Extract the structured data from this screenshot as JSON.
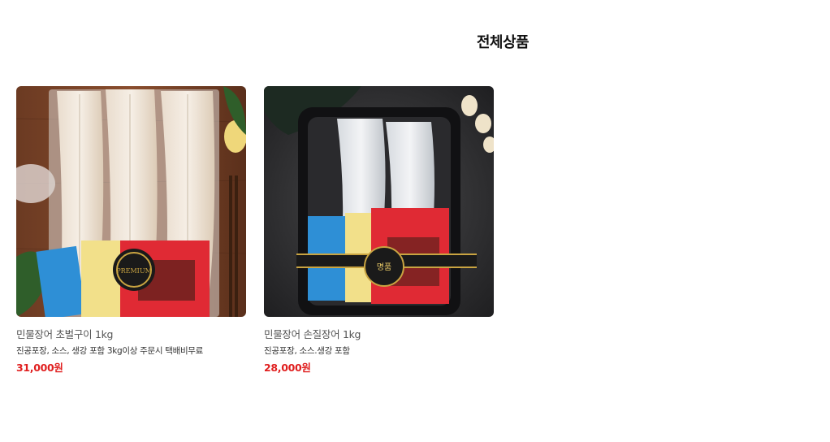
{
  "header": {
    "title": "전체상품"
  },
  "products": [
    {
      "name": "민물장어 초벌구이 1kg",
      "description": "진공포장, 소스, 생강 포함 3kg이상 주문시 택배비무료",
      "price": "31,000원",
      "image_icon": "grilled-eel-package-photo"
    },
    {
      "name": "민물장어 손질장어 1kg",
      "description": "진공포장, 소스.생강 포함",
      "price": "28,000원",
      "image_icon": "raw-eel-tray-photo"
    }
  ],
  "colors": {
    "price": "#e01f1f",
    "title": "#111111",
    "name": "#555555"
  }
}
